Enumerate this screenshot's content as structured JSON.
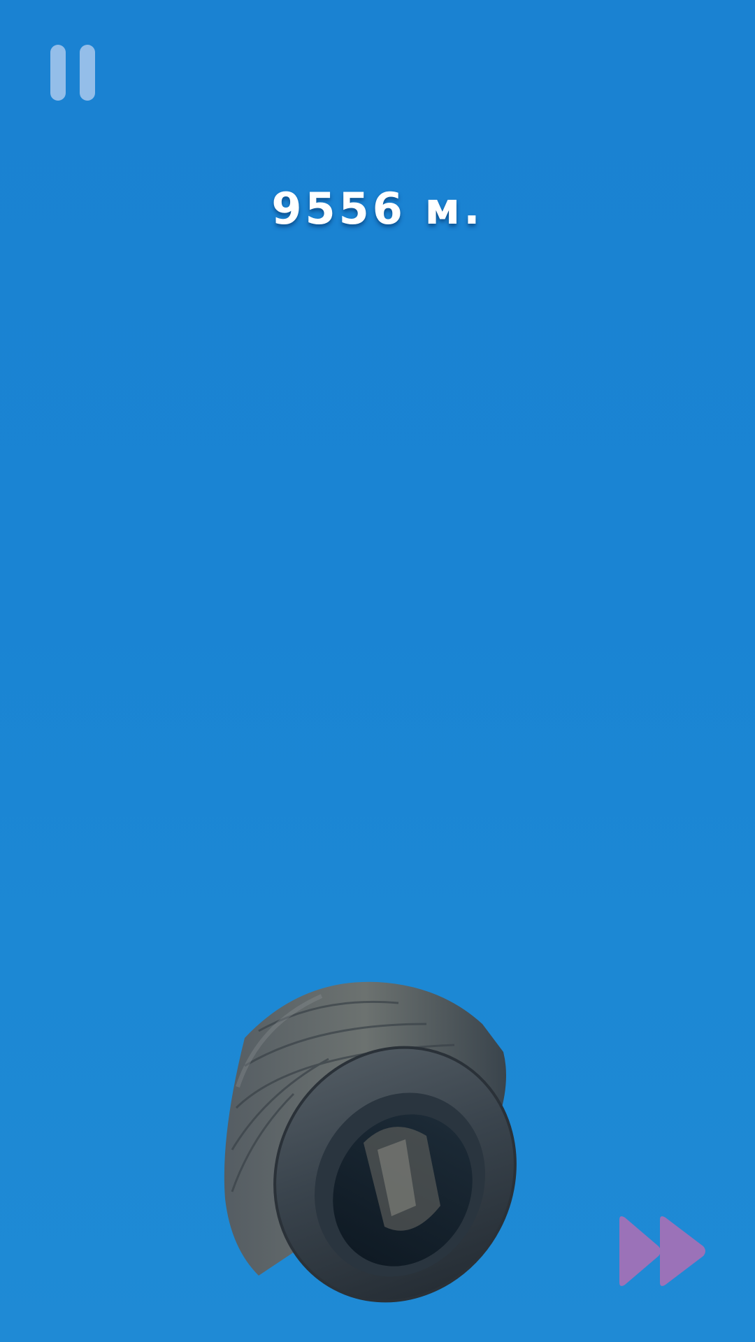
{
  "hud": {
    "distance_value": "9556",
    "distance_unit": "м.",
    "distance_text": "9556 м."
  },
  "controls": {
    "pause_icon": "pause-icon",
    "fast_forward_icon": "fast-forward-icon"
  },
  "colors": {
    "background": "#1a84d3",
    "pause_icon": "#bed2f0",
    "fast_forward_icon": "#9b72b8",
    "text": "#ffffff",
    "tire": "#2f3942"
  }
}
